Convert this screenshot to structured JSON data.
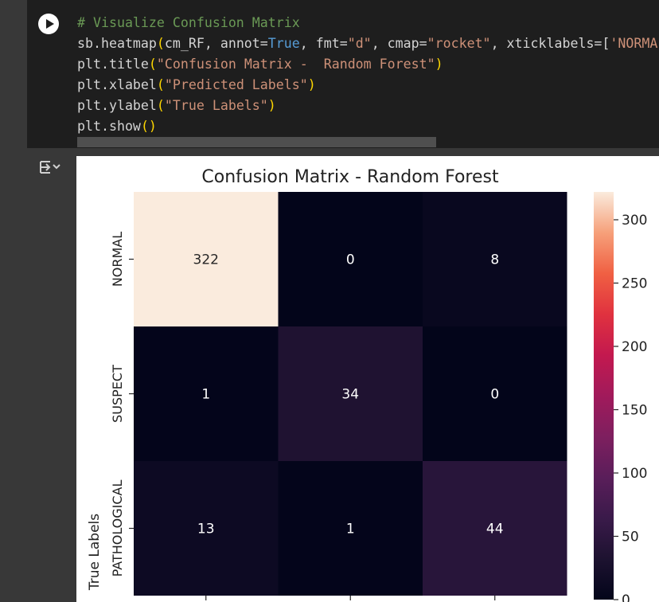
{
  "code_cell": {
    "run_button_label": "Run cell",
    "lines": [
      {
        "tokens": [
          {
            "t": "# Visualize Confusion Matrix",
            "c": "c-com"
          }
        ]
      },
      {
        "tokens": [
          {
            "t": "sb.heatmap",
            "c": ""
          },
          {
            "t": "(",
            "c": "c-par"
          },
          {
            "t": "cm_RF, annot=",
            "c": ""
          },
          {
            "t": "True",
            "c": "c-kw"
          },
          {
            "t": ", fmt=",
            "c": ""
          },
          {
            "t": "\"d\"",
            "c": "c-str"
          },
          {
            "t": ", cmap=",
            "c": ""
          },
          {
            "t": "\"rocket\"",
            "c": "c-str"
          },
          {
            "t": ", xticklabels=[",
            "c": ""
          },
          {
            "t": "'NORMAL'",
            "c": "c-str"
          }
        ]
      },
      {
        "tokens": [
          {
            "t": "plt.title",
            "c": ""
          },
          {
            "t": "(",
            "c": "c-par"
          },
          {
            "t": "\"Confusion Matrix -  Random Forest\"",
            "c": "c-str"
          },
          {
            "t": ")",
            "c": "c-par"
          }
        ]
      },
      {
        "tokens": [
          {
            "t": "plt.xlabel",
            "c": ""
          },
          {
            "t": "(",
            "c": "c-par"
          },
          {
            "t": "\"Predicted Labels\"",
            "c": "c-str"
          },
          {
            "t": ")",
            "c": "c-par"
          }
        ]
      },
      {
        "tokens": [
          {
            "t": "plt.ylabel",
            "c": ""
          },
          {
            "t": "(",
            "c": "c-par"
          },
          {
            "t": "\"True Labels\"",
            "c": "c-str"
          },
          {
            "t": ")",
            "c": "c-par"
          }
        ]
      },
      {
        "tokens": [
          {
            "t": "plt.show",
            "c": ""
          },
          {
            "t": "()",
            "c": "c-par"
          }
        ]
      }
    ]
  },
  "output": {
    "toggle_icon": "output-toggle-icon"
  },
  "chart_data": {
    "type": "heatmap",
    "title": "Confusion Matrix -  Random Forest",
    "xlabel": "",
    "ylabel": "True Labels",
    "row_labels": [
      "NORMAL",
      "SUSPECT",
      "PATHOLOGICAL"
    ],
    "matrix": [
      [
        322,
        0,
        8
      ],
      [
        1,
        34,
        0
      ],
      [
        13,
        1,
        44
      ]
    ],
    "colormap": "rocket",
    "colorbar_ticks": [
      0,
      50,
      100,
      150,
      200,
      250,
      300
    ],
    "colorbar_range": [
      0,
      322
    ],
    "annotation_colors": {
      "light_cell": "#262626",
      "dark_cell": "#ffffff"
    }
  }
}
